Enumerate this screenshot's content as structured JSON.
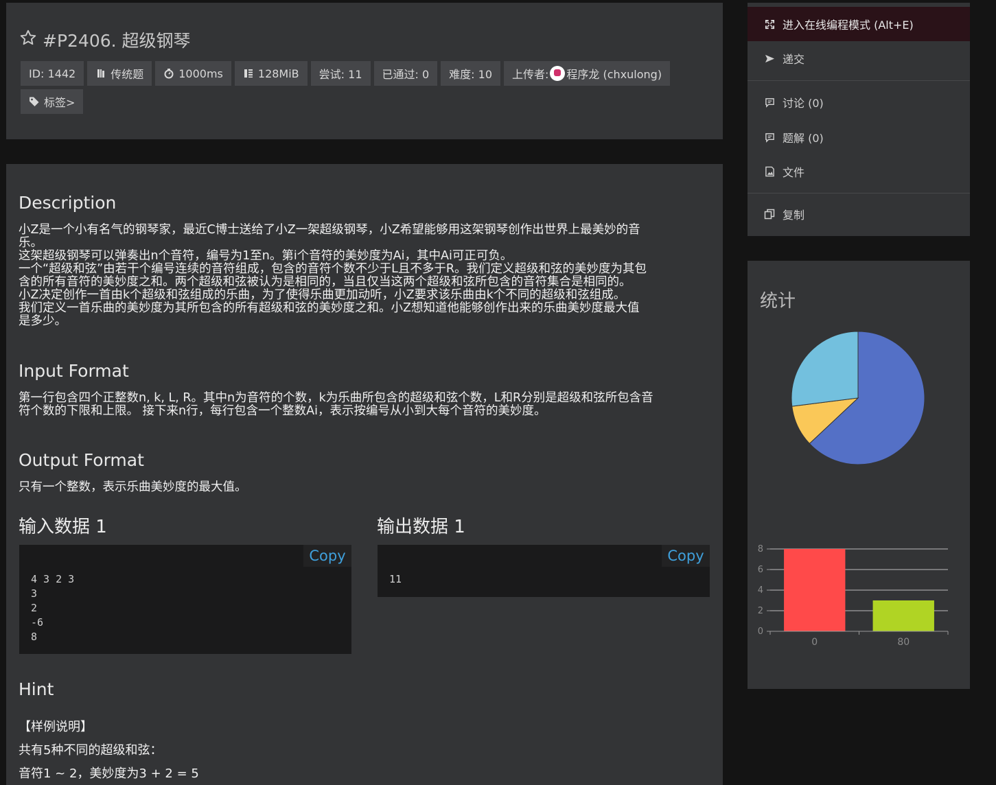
{
  "problem": {
    "title": "#P2406. 超级钢琴",
    "badges": {
      "id": "ID: 1442",
      "type": "传统题",
      "time": "1000ms",
      "memory": "128MiB",
      "tries": "尝试: 11",
      "passed": "已通过: 0",
      "difficulty": "难度: 10",
      "uploader_label": "上传者:",
      "uploader_name": "程序龙 (chxulong)",
      "tags": "标签>"
    }
  },
  "content": {
    "description_heading": "Description",
    "description_lines": [
      "小Z是一个小有名气的钢琴家，最近C博士送给了小Z一架超级钢琴，小Z希望能够用这架钢琴创作出世界上最美妙的音",
      "乐。",
      "这架超级钢琴可以弹奏出n个音符，编号为1至n。第i个音符的美妙度为Ai，其中Ai可正可负。",
      "一个“超级和弦”由若干个编号连续的音符组成，包含的音符个数不少于L且不多于R。我们定义超级和弦的美妙度为其包",
      "含的所有音符的美妙度之和。两个超级和弦被认为是相同的，当且仅当这两个超级和弦所包含的音符集合是相同的。",
      "小Z决定创作一首由k个超级和弦组成的乐曲，为了使得乐曲更加动听，小Z要求该乐曲由k个不同的超级和弦组成。",
      "我们定义一首乐曲的美妙度为其所包含的所有超级和弦的美妙度之和。小Z想知道他能够创作出来的乐曲美妙度最大值",
      "是多少。"
    ],
    "input_heading": "Input Format",
    "input_lines": [
      "第一行包含四个正整数n, k, L, R。其中n为音符的个数，k为乐曲所包含的超级和弦个数，L和R分别是超级和弦所包含音",
      "符个数的下限和上限。 接下来n行，每行包含一个整数Ai，表示按编号从小到大每个音符的美妙度。"
    ],
    "output_heading": "Output Format",
    "output_text": "只有一个整数，表示乐曲美妙度的最大值。",
    "sample_input_heading": "输入数据 1",
    "sample_output_heading": "输出数据 1",
    "copy_label": "Copy",
    "sample_input": "4 3 2 3\n3\n2\n-6\n8",
    "sample_output": "11",
    "hint_heading": "Hint",
    "hint_lines": [
      "【样例说明】",
      "共有5种不同的超级和弦：",
      "音符1 ~ 2，美妙度为3 + 2 = 5"
    ]
  },
  "menu": {
    "online_mode": "进入在线编程模式 (Alt+E)",
    "submit": "递交",
    "discuss": "讨论 (0)",
    "solutions": "题解 (0)",
    "files": "文件",
    "copy": "复制"
  },
  "stats": {
    "title": "统计",
    "colors": {
      "blue": "#5470c6",
      "yellow": "#fac858",
      "cyan": "#73c0de",
      "red": "#ff4a4a",
      "green": "#b0d424"
    }
  },
  "chart_data": [
    {
      "type": "pie",
      "values": [
        63,
        10,
        27
      ],
      "colors": [
        "#5470c6",
        "#fac858",
        "#73c0de"
      ]
    },
    {
      "type": "bar",
      "categories": [
        "0",
        "80"
      ],
      "values": [
        8,
        3
      ],
      "colors": [
        "#ff4a4a",
        "#b0d424"
      ],
      "ylim": [
        0,
        8
      ],
      "yticks": [
        0,
        2,
        4,
        6,
        8
      ],
      "grid": true
    }
  ]
}
